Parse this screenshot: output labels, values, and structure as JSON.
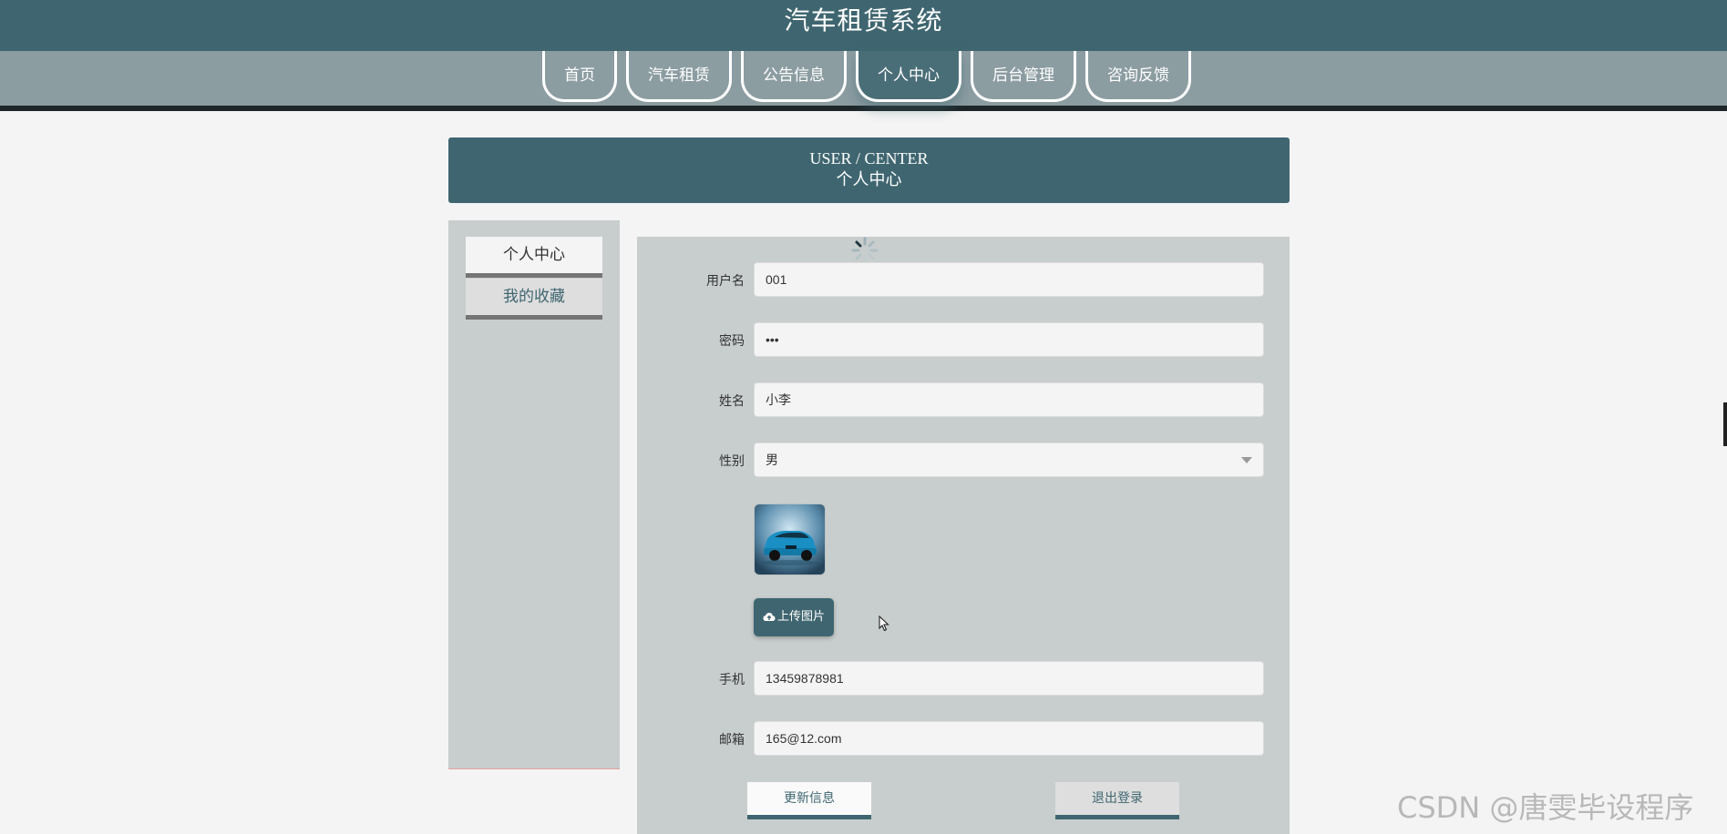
{
  "header": {
    "title": "汽车租赁系统"
  },
  "nav": {
    "items": [
      {
        "label": "首页"
      },
      {
        "label": "汽车租赁"
      },
      {
        "label": "公告信息"
      },
      {
        "label": "个人中心"
      },
      {
        "label": "后台管理"
      },
      {
        "label": "咨询反馈"
      }
    ],
    "active": "个人中心"
  },
  "banner": {
    "en": "USER / CENTER",
    "cn": "个人中心"
  },
  "sidebar": {
    "items": [
      {
        "label": "个人中心"
      },
      {
        "label": "我的收藏"
      }
    ]
  },
  "form": {
    "username": {
      "label": "用户名",
      "value": "001"
    },
    "password": {
      "label": "密码",
      "value": "•••"
    },
    "name": {
      "label": "姓名",
      "value": "小李"
    },
    "gender": {
      "label": "性别",
      "value": "男"
    },
    "upload_label": "上传图片",
    "phone": {
      "label": "手机",
      "value": "13459878981"
    },
    "email": {
      "label": "邮箱",
      "value": "165@12.com"
    },
    "update_label": "更新信息",
    "logout_label": "退出登录"
  },
  "watermark": "CSDN @唐雯毕设程序",
  "colors": {
    "primary": "#3f6670",
    "nav_band": "#8c9da2",
    "panel": "#c8cdcd",
    "background": "#f4f4f4"
  }
}
